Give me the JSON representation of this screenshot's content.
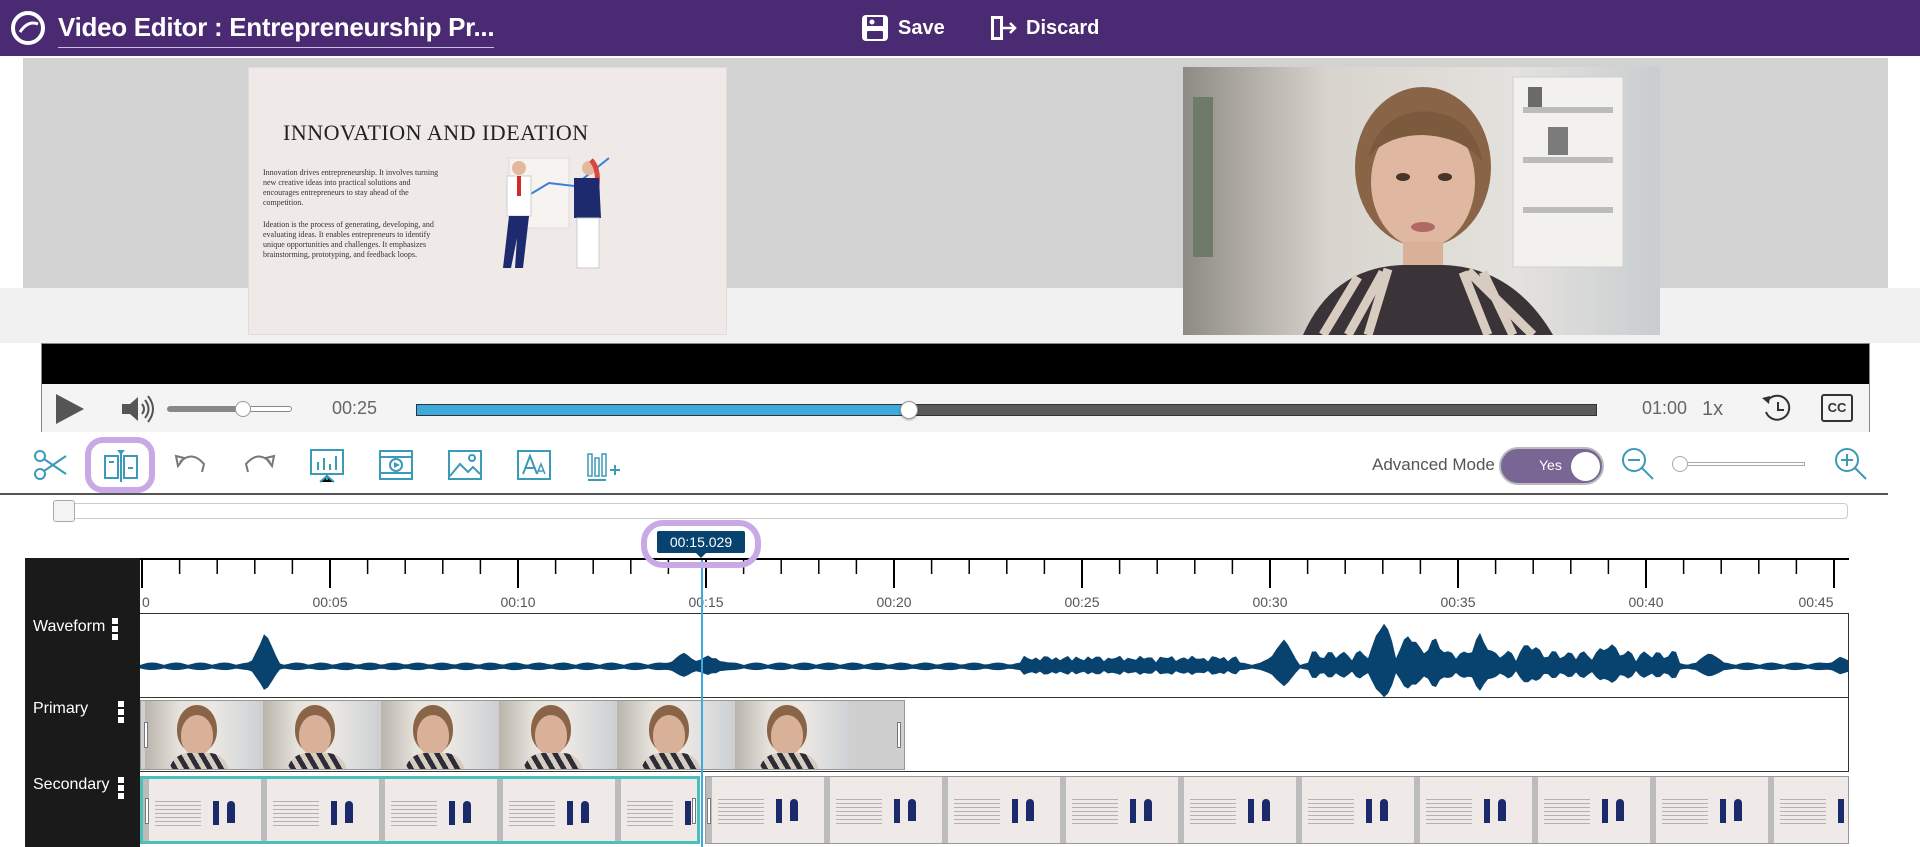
{
  "header": {
    "title": "Video Editor : Entrepreneurship Pr...",
    "save_label": "Save",
    "discard_label": "Discard"
  },
  "slide": {
    "title": "INNOVATION AND IDEATION",
    "paragraph1": "Innovation drives entrepreneurship. It involves turning new creative ideas into practical solutions and encourages entrepreneurs to stay ahead of the competition.",
    "paragraph2": "Ideation is the process of generating, developing, and evaluating ideas. It enables entrepreneurs to identify unique opportunities and challenges. It emphasizes brainstorming, prototyping, and feedback loops."
  },
  "player": {
    "current_time": "00:25",
    "total_time": "01:00",
    "progress_fraction": 0.417,
    "volume_fraction": 0.6,
    "speed_label": "1x",
    "cc_label": "CC"
  },
  "toolbar": {
    "advanced_mode_label": "Advanced Mode",
    "advanced_mode_value": "Yes",
    "zoom_fraction": 0.0
  },
  "timeline": {
    "playhead_label": "00:15.029",
    "ruler_ticks": [
      "0",
      "00:05",
      "00:10",
      "00:15",
      "00:20",
      "00:25",
      "00:30",
      "00:35",
      "00:40",
      "00:45"
    ],
    "tracks": [
      "Waveform",
      "Primary",
      "Secondary"
    ]
  },
  "colors": {
    "header": "#4a2a72",
    "accent": "#3da9dd",
    "icon": "#3a9ab8",
    "highlight": "#c9a8e6",
    "waveform": "#07436e",
    "selected_clip": "#4cc0b8"
  }
}
